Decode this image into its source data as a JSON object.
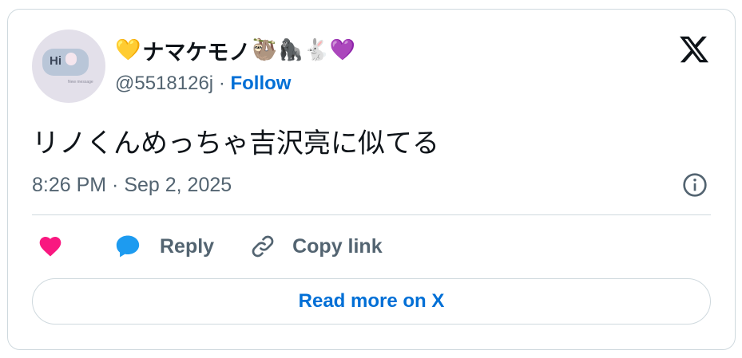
{
  "author": {
    "display_name": "ナマケモノ",
    "emoji_prefix": "💛",
    "emoji_suffix": "🦥🦍🐇💜",
    "handle": "@5518126j",
    "separator": "·",
    "follow_label": "Follow",
    "avatar": {
      "greeting": "Hi",
      "caption": "New message"
    }
  },
  "tweet": {
    "text": "リノくんめっちゃ吉沢亮に似てる",
    "timestamp": "8:26 PM · Sep 2, 2025"
  },
  "actions": {
    "like_icon": "heart-icon",
    "reply_label": "Reply",
    "reply_icon": "speech-bubble-icon",
    "copy_label": "Copy link",
    "copy_icon": "link-icon"
  },
  "read_more_label": "Read more on X",
  "colors": {
    "link_blue": "#006fd6",
    "like_pink": "#f91880",
    "reply_blue": "#1d9bf0",
    "muted_text": "#536471",
    "border": "#cfd9de"
  }
}
